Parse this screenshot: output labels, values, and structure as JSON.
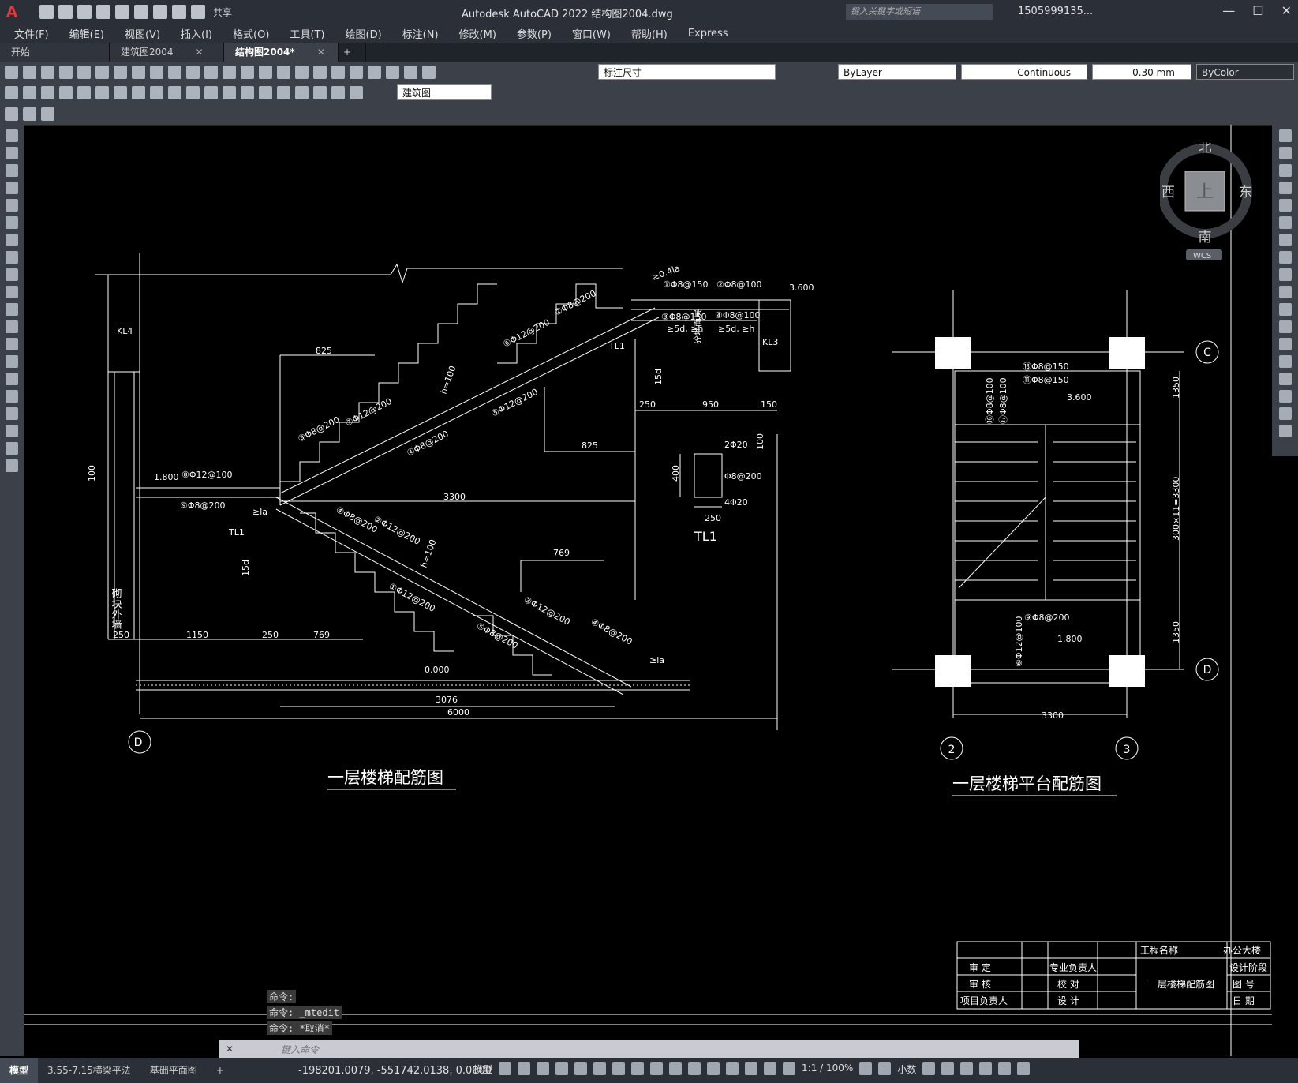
{
  "app": {
    "logo": "A",
    "share_label": "共享",
    "title": "Autodesk AutoCAD 2022    结构图2004.dwg",
    "search_placeholder": "键入关键字或短语",
    "account": "1505999135...",
    "window_controls": [
      "—",
      "☐",
      "✕"
    ]
  },
  "menu": [
    "文件(F)",
    "编辑(E)",
    "视图(V)",
    "插入(I)",
    "格式(O)",
    "工具(T)",
    "绘图(D)",
    "标注(N)",
    "修改(M)",
    "参数(P)",
    "窗口(W)",
    "帮助(H)",
    "Express"
  ],
  "tabs": [
    {
      "label": "开始",
      "closable": false
    },
    {
      "label": "建筑图2004",
      "closable": true
    },
    {
      "label": "结构图2004*",
      "closable": true,
      "active": true
    }
  ],
  "toolbar": {
    "dimstyle": "标注尺寸",
    "layer_color": "ByLayer",
    "linetype": "Continuous",
    "lineweight": "0.30 mm",
    "plotstyle": "ByColor",
    "textstyle": "建筑图"
  },
  "viewcube": {
    "north": "北",
    "south": "南",
    "east": "东",
    "west": "西",
    "top": "上",
    "ucs": "WCS"
  },
  "drawing": {
    "left_title": "一层楼梯配筋图",
    "right_title": "一层楼梯平台配筋图",
    "tl1_label": "TL1",
    "kl4": "KL4",
    "kl3": "KL3",
    "wall_label": "砌块外墙",
    "floor_label": "砼地面层",
    "grid_d": "D",
    "grid_c": "C",
    "grid_2": "2",
    "grid_3": "3",
    "elev_3600": "3.600",
    "elev_1800": "1.800",
    "elev_0000": "0.000",
    "dims": {
      "d825a": "825",
      "d825b": "825",
      "d3300": "3300",
      "d250a": "250",
      "d950": "950",
      "d150": "150",
      "d100a": "100",
      "d100b": "100",
      "d400": "400",
      "d250b": "250",
      "d769a": "769",
      "d769b": "769",
      "d1150": "1150",
      "d250c": "250",
      "d250d": "250",
      "d3076": "3076",
      "d6000": "6000",
      "d1350a": "1350",
      "d1350b": "1350",
      "d300x11": "300×11=3300",
      "d3300b": "3300"
    },
    "rebar": {
      "r1": "①Φ8@150",
      "r2": "②Φ8@100",
      "r3": "③Φ8@150",
      "r4": "④Φ8@100",
      "r5": "⑧Φ12@100",
      "r6": "⑨Φ8@200",
      "r7": "⑥Φ12@200",
      "r8": "②Φ8@200",
      "r9": "⑤Φ12@200",
      "r10": "④Φ8@200",
      "r11": "⑦Φ12@200",
      "r12": "③Φ8@200",
      "r13": "④Φ8@200",
      "r14": "②Φ12@200",
      "r15": "①Φ12@200",
      "r16": "③Φ12@200",
      "r17": "⑤Φ8@200",
      "r18": "④Φ8@200",
      "tl_top": "2Φ20",
      "tl_mid": "Φ8@200",
      "tl_bot": "4Φ20",
      "p1": "⑬Φ8@150",
      "p2": "⑪Φ8@150",
      "p3": "⑯Φ8@100",
      "p4": "⑰Φ8@100",
      "p5": "⑨Φ8@200",
      "p6": "⑥Φ12@100"
    },
    "anchor_la": "≥la",
    "anchor_5d": "≥5d, ≥h",
    "h100": "h=100",
    "d15": "15d",
    "d04": "≥0.4la"
  },
  "titleblock": {
    "project_name_label": "工程名称",
    "project_name": "办公大楼",
    "approve": "审  定",
    "review": "审  核",
    "pm": "项目负责人",
    "discipline_lead": "专业负责人",
    "check": "校  对",
    "design": "设  计",
    "drawing_name": "一层楼梯配筋图",
    "stage": "设计阶段",
    "drawing_no": "图  号",
    "date": "日  期"
  },
  "command": {
    "history": [
      "命令:",
      "命令: _mtedit",
      "命令: *取消*"
    ],
    "placeholder": "键入命令"
  },
  "status": {
    "layout_tabs": [
      "模型",
      "3.55-7.15横梁平法",
      "基础平面图"
    ],
    "coords": "-198201.0079, -551742.0138, 0.0000",
    "model": "模型",
    "scale": "1:1 / 100%",
    "units": "小数"
  }
}
